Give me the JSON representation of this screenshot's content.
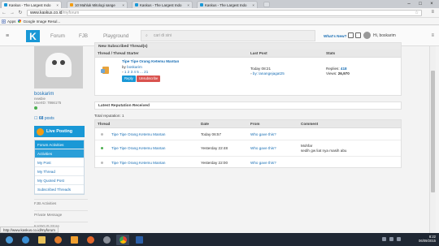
{
  "browser": {
    "tabs": [
      {
        "title": "Kaskus - The Largest Indo",
        "color": "#1998d6"
      },
      {
        "title": "10 Mahluk Mitologi sange",
        "color": "#f39c12"
      },
      {
        "title": "Kaskus - The Largest Indo",
        "color": "#1998d6"
      },
      {
        "title": "Kaskus - The Largest Indo",
        "color": "#1998d6"
      }
    ],
    "url_domain": "www.kaskus.co.id",
    "url_path": "/myforum",
    "bookmarks": {
      "apps_label": "Apps",
      "google_label": "Google Image Resul..."
    }
  },
  "header": {
    "logo": "K",
    "nav": [
      "Forum",
      "FJB",
      "Playground"
    ],
    "search_placeholder": "cari di sini",
    "whats_new": "What's New?",
    "username": "Hi, boskarim"
  },
  "sidebar": {
    "username": "boskarim",
    "rank": "newbie",
    "userid": "UserID: 7866175",
    "posts_count": "68",
    "posts_label": "posts",
    "live_posting": "Live Posting",
    "menu": [
      {
        "label": "Forum Activities",
        "state": "sel"
      },
      {
        "label": "Activities",
        "state": "sel2"
      },
      {
        "label": "My Post",
        "state": ""
      },
      {
        "label": "My Thread",
        "state": ""
      },
      {
        "label": "My Quoted Post",
        "state": ""
      },
      {
        "label": "Subscribed Threads",
        "state": ""
      }
    ],
    "sections": [
      "FJB Activities",
      "Private Message",
      "KASKUS Store"
    ]
  },
  "subscribed": {
    "heading": "New Subscribed Thread(s)",
    "columns": [
      "Thread / Thread Starter",
      "Last Post",
      "Stats"
    ],
    "thread_title": "Tipe Tipe Orang Ketemu Mantan",
    "by": "by",
    "starter": "boskarim",
    "pages": "1 2 3 4 5 ... 21",
    "reply": "Reply",
    "unsubscribe": "Unsubscribe",
    "last_post_time": "Today 08:21",
    "last_post_by": "by: lanangejagat25",
    "replies_label": "Replies:",
    "replies": "418",
    "views_label": "Views:",
    "views": "26,970"
  },
  "reputation": {
    "heading": "Latest Reputation Received",
    "total_label": "Total reputation:",
    "total": "1",
    "columns": [
      "Thread",
      "Date",
      "From",
      "Comment"
    ],
    "rows": [
      {
        "thread": "Tipe Tipe Orang Ketemu Mantan",
        "date": "Today 06:57",
        "from": "Who gave this?",
        "comment": "",
        "comment2": "",
        "dot": "#bbbbbb"
      },
      {
        "thread": "Tipe Tipe Orang Ketemu Mantan",
        "date": "Yesterday 22:48",
        "from": "Who gave this?",
        "comment": "Mohfar",
        "comment2": "sedih gw liat nya masih abu",
        "dot": "#4caf50"
      },
      {
        "thread": "Tipe Tipe Orang Ketemu Mantan",
        "date": "Yesterday 22:00",
        "from": "Who gave this?",
        "comment": "",
        "comment2": "",
        "dot": "#bbbbbb"
      }
    ]
  },
  "status_url": "http://www.kaskus.co.id/myforum",
  "clock": {
    "time": "8:22",
    "date": "06/09/2015"
  }
}
